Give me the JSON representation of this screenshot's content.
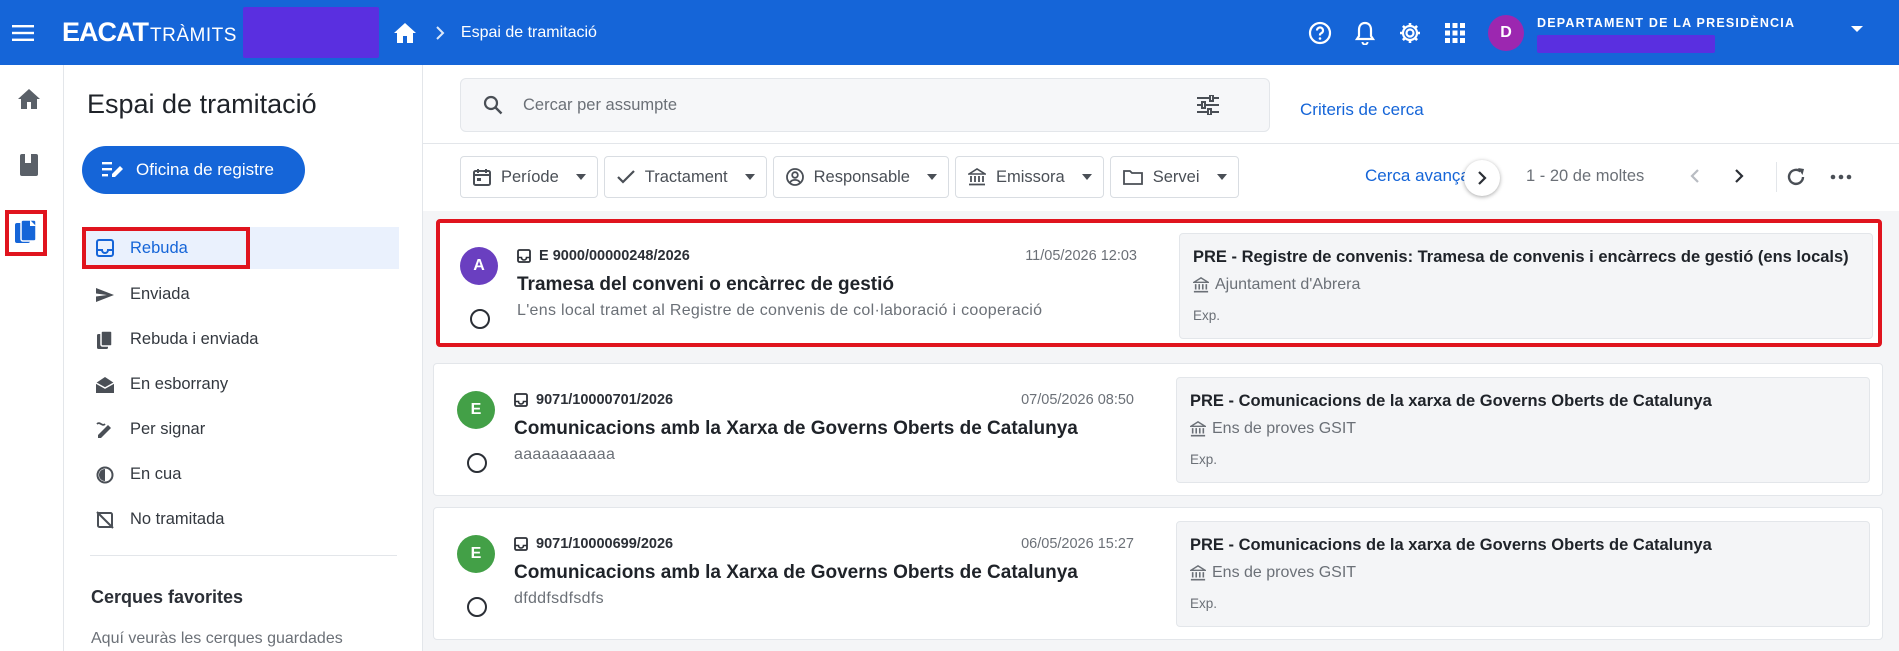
{
  "header": {
    "logo_main": "EACAT",
    "logo_sub": "TRÀMITS",
    "breadcrumb": "Espai de tramitació",
    "department": "DEPARTAMENT DE LA PRESIDÈNCIA",
    "user_initial": "D",
    "accent": "#1565d8"
  },
  "rail": {
    "items": [
      "home-icon",
      "book-icon",
      "documents-icon"
    ]
  },
  "nav": {
    "title": "Espai de tramitació",
    "register_button": "Oficina de registre",
    "items": [
      {
        "label": "Rebuda",
        "icon": "inbox-icon"
      },
      {
        "label": "Enviada",
        "icon": "send-icon"
      },
      {
        "label": "Rebuda i enviada",
        "icon": "copy-icon"
      },
      {
        "label": "En esborrany",
        "icon": "open-mail-icon"
      },
      {
        "label": "Per signar",
        "icon": "sign-icon"
      },
      {
        "label": "En cua",
        "icon": "queue-icon"
      },
      {
        "label": "No tramitada",
        "icon": "not-processed-icon"
      }
    ],
    "favorites_title": "Cerques favorites",
    "favorites_hint": "Aquí veuràs les cerques guardades"
  },
  "search": {
    "placeholder": "Cercar per assumpte",
    "criteria_link": "Criteris de cerca"
  },
  "filters": {
    "chips": [
      "Període",
      "Tractament",
      "Responsable",
      "Emissora",
      "Servei"
    ],
    "advanced": "Cerca avançada",
    "paging": "1 - 20 de moltes"
  },
  "records": [
    {
      "avatar": "A",
      "avatar_color": "#6a3fc0",
      "register": "E 9000/00000248/2026",
      "date": "11/05/2026 12:03",
      "subject": "Tramesa del conveni o encàrrec de gestió",
      "description": "L'ens local tramet al Registre de convenis de col·laboració i cooperació",
      "side_title": "PRE - Registre de convenis: Tramesa de convenis i encàrrecs de gestió (ens locals)",
      "organization": "Ajuntament d'Abrera",
      "exp": "Exp."
    },
    {
      "avatar": "E",
      "avatar_color": "#43a047",
      "register": "9071/10000701/2026",
      "date": "07/05/2026 08:50",
      "subject": "Comunicacions amb la Xarxa de Governs Oberts de Catalunya",
      "description": "aaaaaaaaaaa",
      "side_title": "PRE - Comunicacions de la xarxa de Governs Oberts de Catalunya",
      "organization": "Ens de proves GSIT",
      "exp": "Exp."
    },
    {
      "avatar": "E",
      "avatar_color": "#43a047",
      "register": "9071/10000699/2026",
      "date": "06/05/2026 15:27",
      "subject": "Comunicacions amb la Xarxa de Governs Oberts de Catalunya",
      "description": "dfddfsdfsdfs",
      "side_title": "PRE - Comunicacions de la xarxa de Governs Oberts de Catalunya",
      "organization": "Ens de proves GSIT",
      "exp": "Exp."
    }
  ]
}
